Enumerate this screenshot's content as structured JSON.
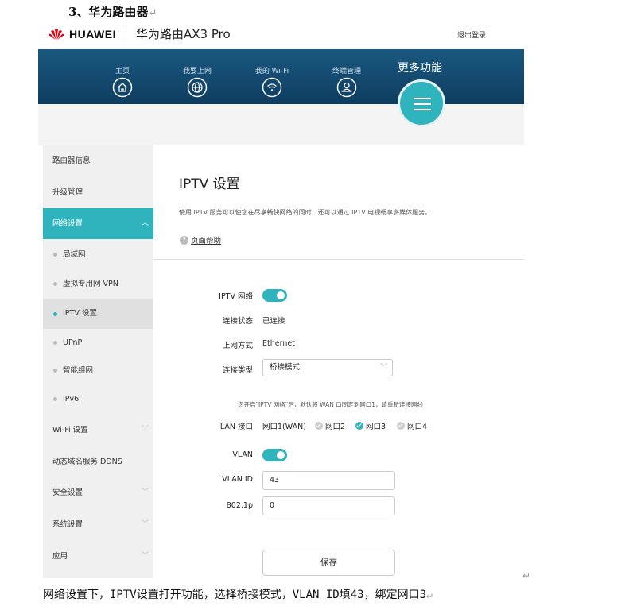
{
  "doc": {
    "heading": "3、华为路由器",
    "caption": "网络设置下，IPTV设置打开功能，选择桥接模式，VLAN ID填43，绑定网口3",
    "para_mark": "↵"
  },
  "header": {
    "brand": "HUAWEI",
    "product": "华为路由AX3 Pro",
    "logout": "退出登录"
  },
  "nav": {
    "items": [
      {
        "label": "主页",
        "icon": "home-icon"
      },
      {
        "label": "我要上网",
        "icon": "globe-icon"
      },
      {
        "label": "我的 Wi-Fi",
        "icon": "wifi-icon"
      },
      {
        "label": "终端管理",
        "icon": "user-icon"
      }
    ],
    "more": "更多功能",
    "more_icon": "menu-icon"
  },
  "sidebar": {
    "items": [
      {
        "label": "路由器信息"
      },
      {
        "label": "升级管理"
      },
      {
        "label": "网络设置",
        "state": "expanded"
      },
      {
        "label": "局域网"
      },
      {
        "label": "虚拟专用网 VPN"
      },
      {
        "label": "IPTV 设置",
        "state": "selected"
      },
      {
        "label": "UPnP"
      },
      {
        "label": "智能组网"
      },
      {
        "label": "IPv6"
      },
      {
        "label": "Wi-Fi 设置"
      },
      {
        "label": "动态域名服务 DDNS"
      },
      {
        "label": "安全设置"
      },
      {
        "label": "系统设置"
      },
      {
        "label": "应用"
      }
    ]
  },
  "content": {
    "title": "IPTV 设置",
    "description": "使用 IPTV 服务可以使您在尽享畅快网络的同时，还可以通过 IPTV 电视畅享多媒体服务。",
    "help": "页面帮助",
    "form": {
      "iptv_label": "IPTV 网络",
      "iptv_on": true,
      "status_label": "连接状态",
      "status_value": "已连接",
      "wan_label": "上网方式",
      "wan_value": "Ethernet",
      "type_label": "连接类型",
      "type_value": "桥接模式",
      "hint": "您开启\"IPTV 网络\"后，默认将 WAN 口固定到网口1，请重新连接网线",
      "lan_label": "LAN 接口",
      "ports": [
        {
          "label": "网口1(WAN)",
          "checked": false
        },
        {
          "label": "网口2",
          "checked": false
        },
        {
          "label": "网口3",
          "checked": true
        },
        {
          "label": "网口4",
          "checked": false
        }
      ],
      "vlan_label": "VLAN",
      "vlan_on": true,
      "vlan_id_label": "VLAN ID",
      "vlan_id_value": "43",
      "p8021_label": "802.1p",
      "p8021_value": "0",
      "save": "保存"
    }
  },
  "colors": {
    "accent": "#2fb4bd",
    "nav_bg": "#14496f",
    "brand_red": "#e60012"
  }
}
